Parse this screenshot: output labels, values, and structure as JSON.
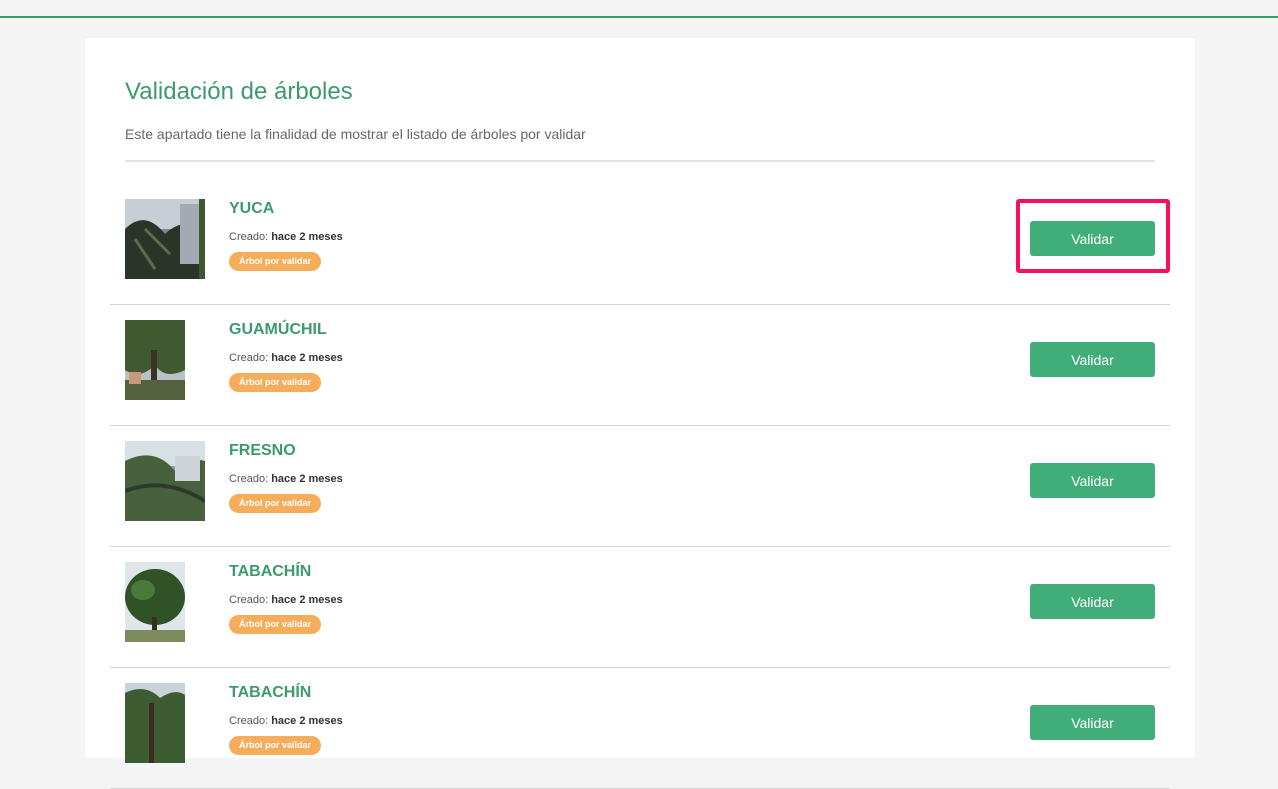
{
  "page": {
    "title": "Validación de árboles",
    "subtitle": "Este apartado tiene la finalidad de mostrar el listado de árboles por validar"
  },
  "colors": {
    "brand_green": "#3d9a6c",
    "button_green": "#41ae79",
    "badge_orange": "#f5ad5b",
    "highlight_pink": "#f5115d"
  },
  "trees": [
    {
      "name": "YUCA",
      "created_label": "Creado:",
      "created_value": "hace 2 meses",
      "status": "Árbol por validar",
      "action": "Validar",
      "photo_icon": "tree-photo"
    },
    {
      "name": "GUAMÚCHIL",
      "created_label": "Creado:",
      "created_value": "hace 2 meses",
      "status": "Árbol por validar",
      "action": "Validar",
      "photo_icon": "tree-photo"
    },
    {
      "name": "FRESNO",
      "created_label": "Creado:",
      "created_value": "hace 2 meses",
      "status": "Árbol por validar",
      "action": "Validar",
      "photo_icon": "tree-photo"
    },
    {
      "name": "TABACHÍN",
      "created_label": "Creado:",
      "created_value": "hace 2 meses",
      "status": "Árbol por validar",
      "action": "Validar",
      "photo_icon": "tree-photo"
    },
    {
      "name": "TABACHÍN",
      "created_label": "Creado:",
      "created_value": "hace 2 meses",
      "status": "Árbol por validar",
      "action": "Validar",
      "photo_icon": "tree-photo"
    }
  ]
}
